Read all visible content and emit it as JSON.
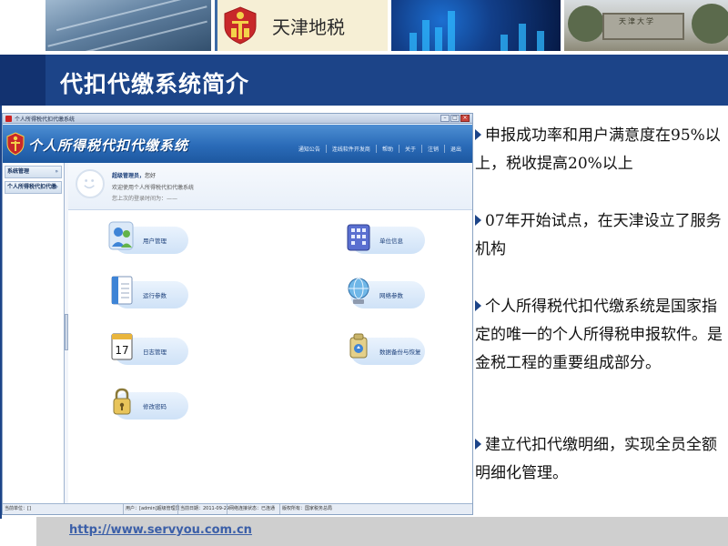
{
  "banner": {
    "org_name": "天津地税",
    "gate_sign": "天津大学"
  },
  "slide_title": "代扣代缴系统简介",
  "app": {
    "window_title": "个人所得税代扣代缴系统",
    "brand": "个人所得税代扣代缴系统",
    "top_nav": [
      "通知公告",
      "连线软件开发商",
      "帮助",
      "关于",
      "注销",
      "退出"
    ],
    "sidebar": [
      {
        "label": "系统管理",
        "chevron": "»"
      },
      {
        "label": "个人所得税代扣代缴",
        "chevron": "»"
      }
    ],
    "welcome": {
      "greeting_label": "超级管理员，",
      "greeting_suffix": "您好",
      "line2": "欢迎使用个人所得税代扣代缴系统",
      "line3": "您上次的登录时间为：——"
    },
    "tiles": [
      {
        "label": "用户管理",
        "icon": "users-icon"
      },
      {
        "label": "单位信息",
        "icon": "building-icon"
      },
      {
        "label": "运行参数",
        "icon": "document-icon"
      },
      {
        "label": "网络参数",
        "icon": "network-icon"
      },
      {
        "label": "日志管理",
        "icon": "calendar-icon",
        "icon_text": "17"
      },
      {
        "label": "数据备份与恢复",
        "icon": "backup-icon"
      },
      {
        "label": "修改密码",
        "icon": "lock-icon"
      }
    ],
    "status": {
      "unit": "当前单位：[]",
      "user": "用户：[admin]超级管理员",
      "date": "当前日期：2011-09-29",
      "network": "网络连接状态：已连通",
      "owner": "版权所有：国家税务总局"
    }
  },
  "bullets": [
    "申报成功率和用户满意度在95%以上，税收提高20%以上",
    "07年开始试点，在天津设立了服务机构",
    "个人所得税代扣代缴系统是国家指定的唯一的个人所得税申报软件。是金税工程的重要组成部分。",
    "建立代扣代缴明细，实现全员全额明细化管理。"
  ],
  "footer_url": "http://www.servyou.com.cn",
  "colors": {
    "title_bar": "#1c4488",
    "bullet_arrow": "#1c4488",
    "app_header": "#2a6bb8",
    "footer_bar": "#cfcfcf",
    "footer_link": "#3b5fa8"
  }
}
